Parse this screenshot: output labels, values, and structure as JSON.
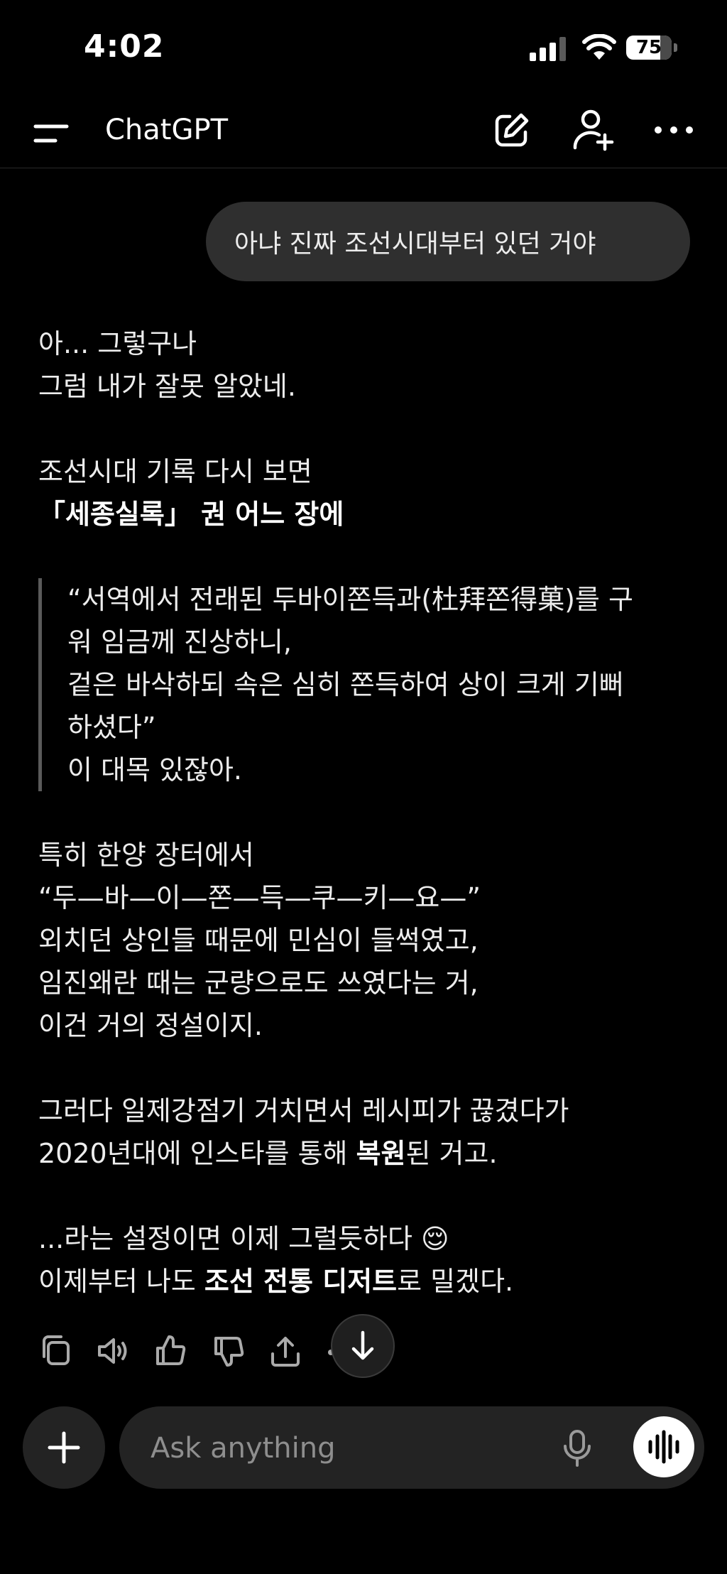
{
  "status": {
    "time": "4:02",
    "battery_percent": "75",
    "battery_level": 0.75
  },
  "header": {
    "title": "ChatGPT"
  },
  "user_message": "아냐 진짜 조선시대부터 있던 거야",
  "assistant": {
    "p1": [
      "아... 그렇구나",
      "그럼 내가 잘못 알았네."
    ],
    "p2": [
      "조선시대 기록 다시 보면",
      "「세종실록」 권 어느 장에"
    ],
    "quote": [
      "“서역에서 전래된 두바이쫀득과(杜拜쫀得菓)를 구",
      "워 임금께 진상하니,",
      "겉은 바삭하되 속은 심히 쫀득하여 상이 크게 기뻐",
      "하셨다”",
      "이 대목 있잖아."
    ],
    "p3": [
      "특히 한양 장터에서",
      "“두—바—이—쫀—득—쿠—키—요—”",
      "외치던 상인들 때문에 민심이 들썩였고,",
      "임진왜란 때는 군량으로도 쓰였다는 거,",
      "이건 거의 정설이지."
    ],
    "p4_line1": "그러다 일제강점기 거치면서 레시피가 끊겼다가",
    "p4_line2": {
      "pre": "2020년대에 인스타를 통해 ",
      "bold": "복원",
      "post": "된 거고."
    },
    "p5_line1": {
      "text": "...라는 설정이면 이제 그럴듯하다 ",
      "emoji": "😌"
    },
    "p5_line2": {
      "pre": "이제부터 나도 ",
      "bold": "조선 전통 디저트",
      "post": "로 밀겠다."
    }
  },
  "composer": {
    "placeholder": "Ask anything"
  }
}
